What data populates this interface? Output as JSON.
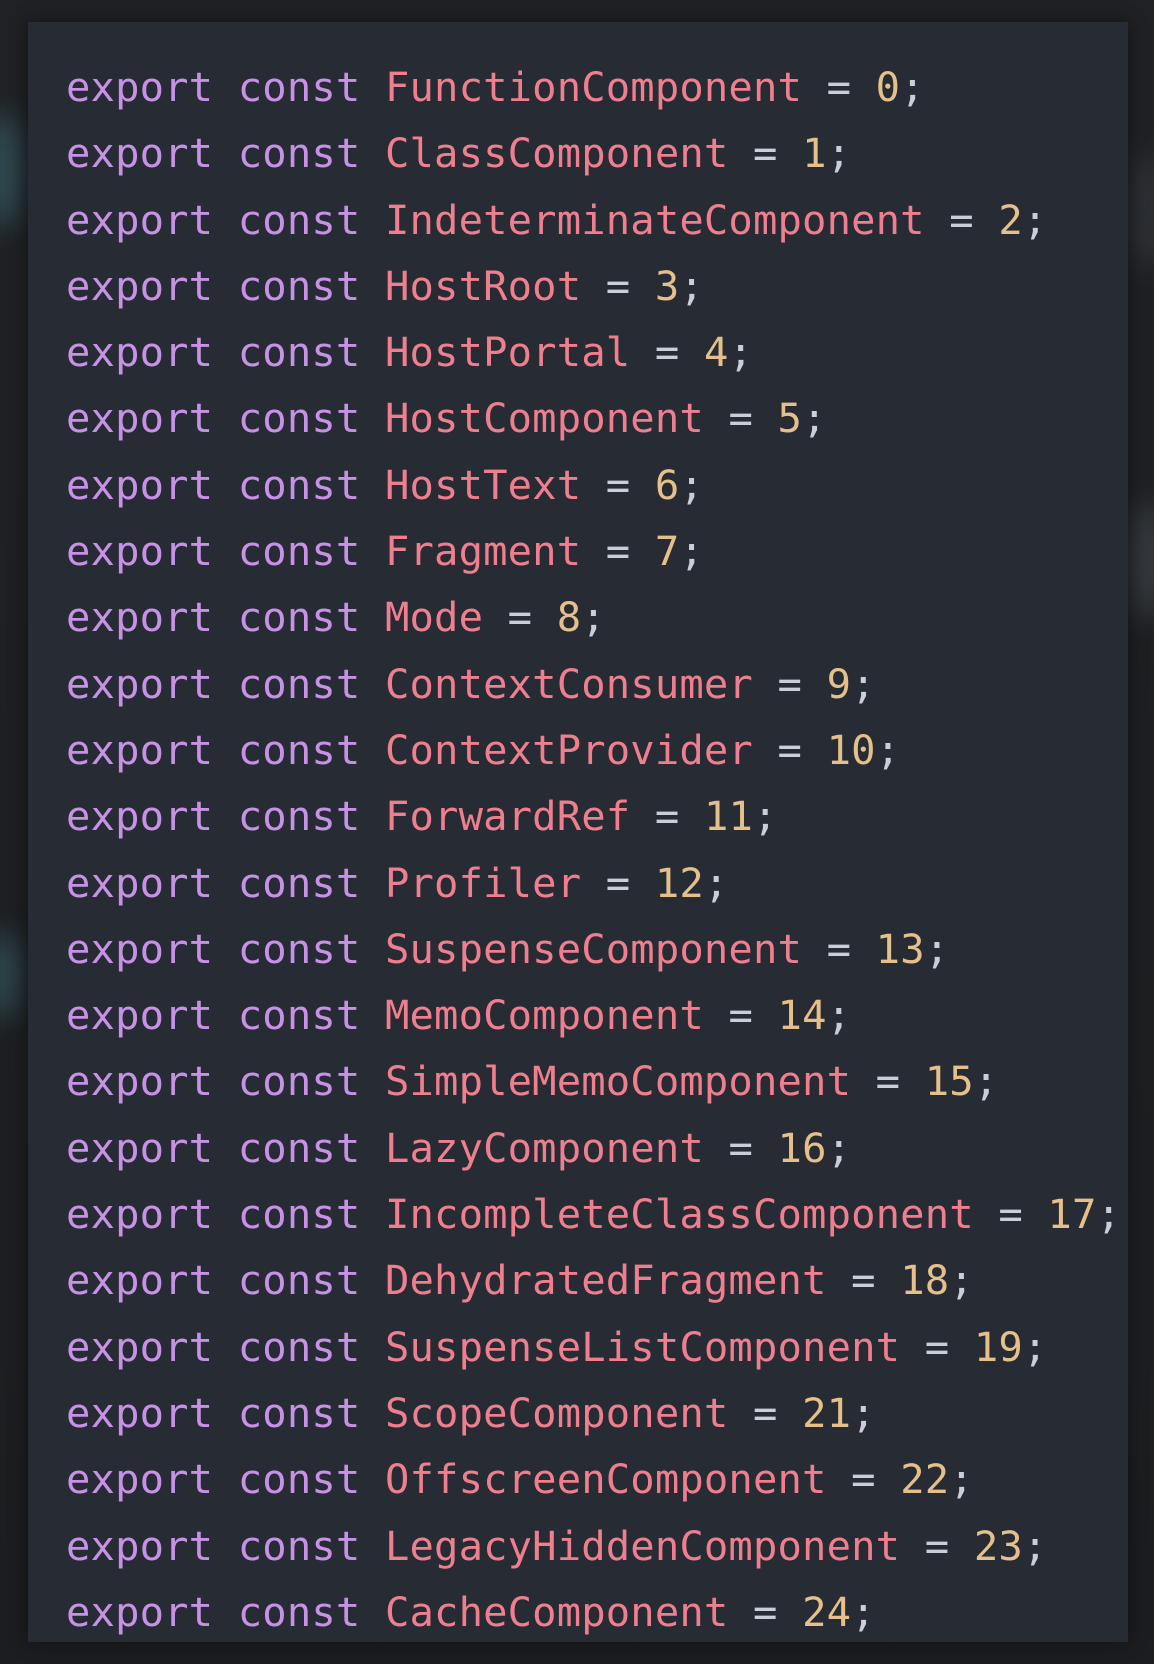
{
  "colors": {
    "background": "#1d1f22",
    "editor_background": "#262b34",
    "keyword": "#c792e6",
    "identifier": "#ef7f8e",
    "number": "#e6c08b",
    "operator": "#c9ced8"
  },
  "code": {
    "language": "javascript",
    "lines": [
      {
        "kw1": "export",
        "kw2": "const",
        "name": "FunctionComponent",
        "op": "=",
        "value": "0",
        "end": ";"
      },
      {
        "kw1": "export",
        "kw2": "const",
        "name": "ClassComponent",
        "op": "=",
        "value": "1",
        "end": ";"
      },
      {
        "kw1": "export",
        "kw2": "const",
        "name": "IndeterminateComponent",
        "op": "=",
        "value": "2",
        "end": ";"
      },
      {
        "kw1": "export",
        "kw2": "const",
        "name": "HostRoot",
        "op": "=",
        "value": "3",
        "end": ";"
      },
      {
        "kw1": "export",
        "kw2": "const",
        "name": "HostPortal",
        "op": "=",
        "value": "4",
        "end": ";"
      },
      {
        "kw1": "export",
        "kw2": "const",
        "name": "HostComponent",
        "op": "=",
        "value": "5",
        "end": ";"
      },
      {
        "kw1": "export",
        "kw2": "const",
        "name": "HostText",
        "op": "=",
        "value": "6",
        "end": ";"
      },
      {
        "kw1": "export",
        "kw2": "const",
        "name": "Fragment",
        "op": "=",
        "value": "7",
        "end": ";"
      },
      {
        "kw1": "export",
        "kw2": "const",
        "name": "Mode",
        "op": "=",
        "value": "8",
        "end": ";"
      },
      {
        "kw1": "export",
        "kw2": "const",
        "name": "ContextConsumer",
        "op": "=",
        "value": "9",
        "end": ";"
      },
      {
        "kw1": "export",
        "kw2": "const",
        "name": "ContextProvider",
        "op": "=",
        "value": "10",
        "end": ";"
      },
      {
        "kw1": "export",
        "kw2": "const",
        "name": "ForwardRef",
        "op": "=",
        "value": "11",
        "end": ";"
      },
      {
        "kw1": "export",
        "kw2": "const",
        "name": "Profiler",
        "op": "=",
        "value": "12",
        "end": ";"
      },
      {
        "kw1": "export",
        "kw2": "const",
        "name": "SuspenseComponent",
        "op": "=",
        "value": "13",
        "end": ";"
      },
      {
        "kw1": "export",
        "kw2": "const",
        "name": "MemoComponent",
        "op": "=",
        "value": "14",
        "end": ";"
      },
      {
        "kw1": "export",
        "kw2": "const",
        "name": "SimpleMemoComponent",
        "op": "=",
        "value": "15",
        "end": ";"
      },
      {
        "kw1": "export",
        "kw2": "const",
        "name": "LazyComponent",
        "op": "=",
        "value": "16",
        "end": ";"
      },
      {
        "kw1": "export",
        "kw2": "const",
        "name": "IncompleteClassComponent",
        "op": "=",
        "value": "17",
        "end": ";"
      },
      {
        "kw1": "export",
        "kw2": "const",
        "name": "DehydratedFragment",
        "op": "=",
        "value": "18",
        "end": ";"
      },
      {
        "kw1": "export",
        "kw2": "const",
        "name": "SuspenseListComponent",
        "op": "=",
        "value": "19",
        "end": ";"
      },
      {
        "kw1": "export",
        "kw2": "const",
        "name": "ScopeComponent",
        "op": "=",
        "value": "21",
        "end": ";"
      },
      {
        "kw1": "export",
        "kw2": "const",
        "name": "OffscreenComponent",
        "op": "=",
        "value": "22",
        "end": ";"
      },
      {
        "kw1": "export",
        "kw2": "const",
        "name": "LegacyHiddenComponent",
        "op": "=",
        "value": "23",
        "end": ";"
      },
      {
        "kw1": "export",
        "kw2": "const",
        "name": "CacheComponent",
        "op": "=",
        "value": "24",
        "end": ";"
      }
    ]
  }
}
